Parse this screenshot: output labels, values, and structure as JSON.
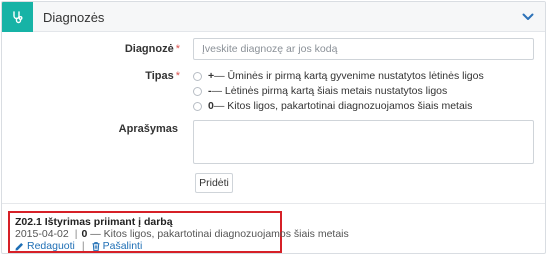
{
  "header": {
    "title": "Diagnozės",
    "icon": "stethoscope-icon",
    "collapse_icon": "chevron-down-icon",
    "accent_color": "#17b3a6"
  },
  "form": {
    "diagnosis": {
      "label": "Diagnozė",
      "required_mark": "*",
      "placeholder": "Įveskite diagnozę ar jos kodą",
      "value": ""
    },
    "type": {
      "label": "Tipas",
      "required_mark": "*",
      "options": [
        {
          "code": "+",
          "text": " — Ūminės ir pirmą kartą gyvenime nustatytos lėtinės ligos",
          "selected": false
        },
        {
          "code": "-",
          "text": " — Lėtinės pirmą kartą šiais metais nustatytos ligos",
          "selected": false
        },
        {
          "code": "0",
          "text": " — Kitos ligos, pakartotinai diagnozuojamos šiais metais",
          "selected": false
        }
      ]
    },
    "description": {
      "label": "Aprašymas",
      "value": ""
    },
    "add_button_label": "Pridėti"
  },
  "entries": [
    {
      "title": "Z02.1 Ištyrimas priimant į darbą",
      "date": "2015-04-02",
      "separator": "|",
      "type_code": "0",
      "type_text": " — Kitos ligos, pakartotinai diagnozuojamos šiais metais",
      "edit_label": "Redaguoti",
      "edit_icon": "pencil-icon",
      "actions_separator": "|",
      "delete_label": "Pašalinti",
      "delete_icon": "trash-icon",
      "highlight_color": "#d62027"
    }
  ]
}
